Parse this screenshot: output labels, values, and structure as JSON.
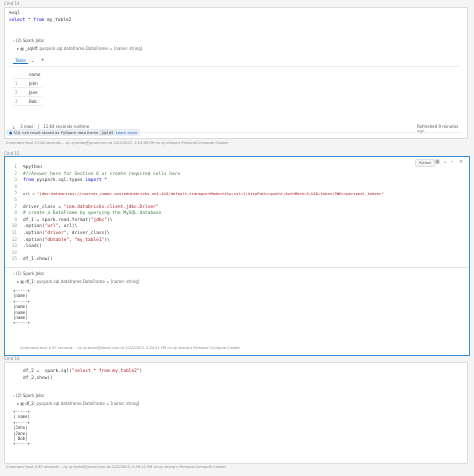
{
  "cells": [
    {
      "header": "Cmd 14",
      "code": [
        "%sql",
        "select * from my_table2"
      ],
      "spark_jobs": "(2) Spark Jobs",
      "df_line": {
        "name": "_sqldf:",
        "type": "pyspark.sql.dataframe.DataFrame = [name: string]"
      },
      "tabs": {
        "table": "Table",
        "add": "+"
      },
      "table": {
        "column": "name",
        "rows": [
          [
            "1",
            "John"
          ],
          [
            "2",
            "Jane"
          ],
          [
            "3",
            "Bob"
          ]
        ]
      },
      "status": {
        "rows": "3 rows",
        "runtime": "11.64 seconds runtime",
        "refreshed": "Refreshed 9 minutes ago"
      },
      "info": {
        "text": "SQL cell result stored as PySpark data frame",
        "var": "_sqldf",
        "link": "Learn more"
      },
      "cmdtook": "Command took 11.64 seconds -- by zy.brian@gmail.com at 2/22/2023, 2:24:06 PM on zy zhang's Personal Compute Cluster"
    },
    {
      "header": "Cmd 15",
      "lang_badge": "Python",
      "code": [
        "%python",
        "#//Answer here for Section 6 or create required cells here",
        "from pyspark.sql.types import *",
        "",
        "url = \"jdbc:databricks://<server_name>.azuredatabricks.net:443/default;transportMode=http;ssl=1;httpPath=<path>;AuthMech=3;UID=token;PWD=<personal_token>\"",
        "",
        "driver_class = \"com.databricks.client.jdbc.Driver\"",
        "# create a DataFrame by querying the MySQL database",
        "df_1 = spark.read.format(\"jdbc\")\\",
        ".option(\"url\", url)\\",
        ".option(\"driver\", driver_class)\\",
        ".option(\"dbtable\", \"my_table1\")\\",
        ".load()",
        "",
        "df_1.show()"
      ],
      "spark_jobs": "(1) Spark Jobs",
      "df_line": {
        "name": "df_1:",
        "type": "pyspark.sql.dataframe.DataFrame = [name: string]"
      },
      "output": [
        "+-----+",
        "|name|",
        "+-----+",
        "|name|",
        "|name|",
        "|name|",
        "+-----+"
      ],
      "cmdtook": "Command took 0.97 seconds -- by zy.brian@gmail.com at 2/22/2023, 2:24:41 PM on zy zhang's Personal Compute Cluster"
    },
    {
      "header": "Cmd 16",
      "code": [
        "df_2 =  spark.sql(\"select * from my_table2\")",
        "df_2.show()"
      ],
      "spark_jobs": "(2) Spark Jobs",
      "df_line": {
        "name": "df_2:",
        "type": "pyspark.sql.dataframe.DataFrame = [name: string]"
      },
      "output": [
        "+-----+",
        "| name|",
        "+-----+",
        "|John|",
        "|Jane|",
        "| Bob|",
        "+-----+"
      ],
      "cmdtook": "Command took 0.92 seconds -- by zy.brian@gmail.com at 2/22/2023, 2:26:12 PM on zy zhang's Personal Compute Cluster"
    }
  ]
}
